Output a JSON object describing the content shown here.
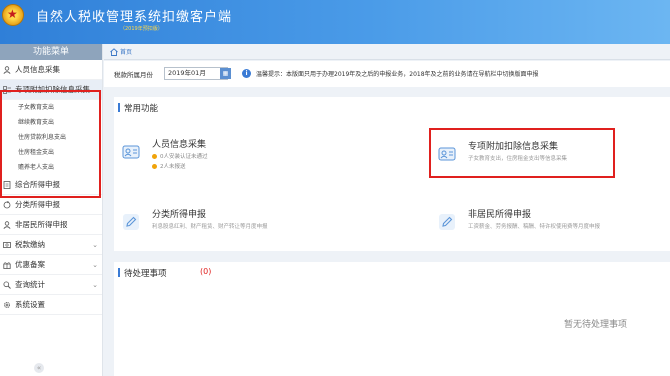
{
  "header": {
    "app_title": "自然人税收管理系统扣缴客户端",
    "app_subtitle": "（2019年预扣版）"
  },
  "sidebar": {
    "title": "功能菜单",
    "items": [
      {
        "label": "人员信息采集",
        "icon": "person-icon"
      },
      {
        "label": "专项附加扣除信息采集",
        "icon": "list-icon",
        "expanded": true,
        "children": [
          "子女教育支出",
          "继续教育支出",
          "住房贷款利息支出",
          "住房租金支出",
          "赡养老人支出"
        ]
      },
      {
        "label": "综合所得申报",
        "icon": "document-icon"
      },
      {
        "label": "分类所得申报",
        "icon": "refresh-icon"
      },
      {
        "label": "非居民所得申报",
        "icon": "person-outline-icon"
      },
      {
        "label": "税款缴纳",
        "icon": "money-icon"
      },
      {
        "label": "优惠备案",
        "icon": "gift-icon"
      },
      {
        "label": "查询统计",
        "icon": "search-icon"
      },
      {
        "label": "系统设置",
        "icon": "gear-icon"
      }
    ],
    "collapse_symbol": "«"
  },
  "breadcrumb": {
    "home_label": "首页"
  },
  "toolbar": {
    "period_label": "税款所属月份",
    "period_value": "2019年01月",
    "notice_label": "温馨提示：",
    "notice_text": "本版面只用于办理2019年及之后的申报业务，2018年及之前的业务请在导航栏中切换版面申报"
  },
  "common_functions": {
    "title": "常用功能",
    "cards": [
      {
        "title": "人员信息采集",
        "stats": [
          "0人安装认证未通过",
          "2人未报送"
        ]
      },
      {
        "title": "专项附加扣除信息采集",
        "desc": "子女教育支出，住房租金支出等信息采集"
      },
      {
        "title": "分类所得申报",
        "desc": "利息股息红利、财产租赁、财产转让等月度申报"
      },
      {
        "title": "非居民所得申报",
        "desc": "工资薪金、劳务报酬、稿酬、特许权使用费等月度申报"
      }
    ]
  },
  "pending": {
    "title": "待处理事项",
    "count": "(0)",
    "empty_text": "暂无待处理事项"
  },
  "colors": {
    "header": "#3a87dc",
    "accent": "#3a7bd5",
    "highlight_border": "#e0201e"
  }
}
